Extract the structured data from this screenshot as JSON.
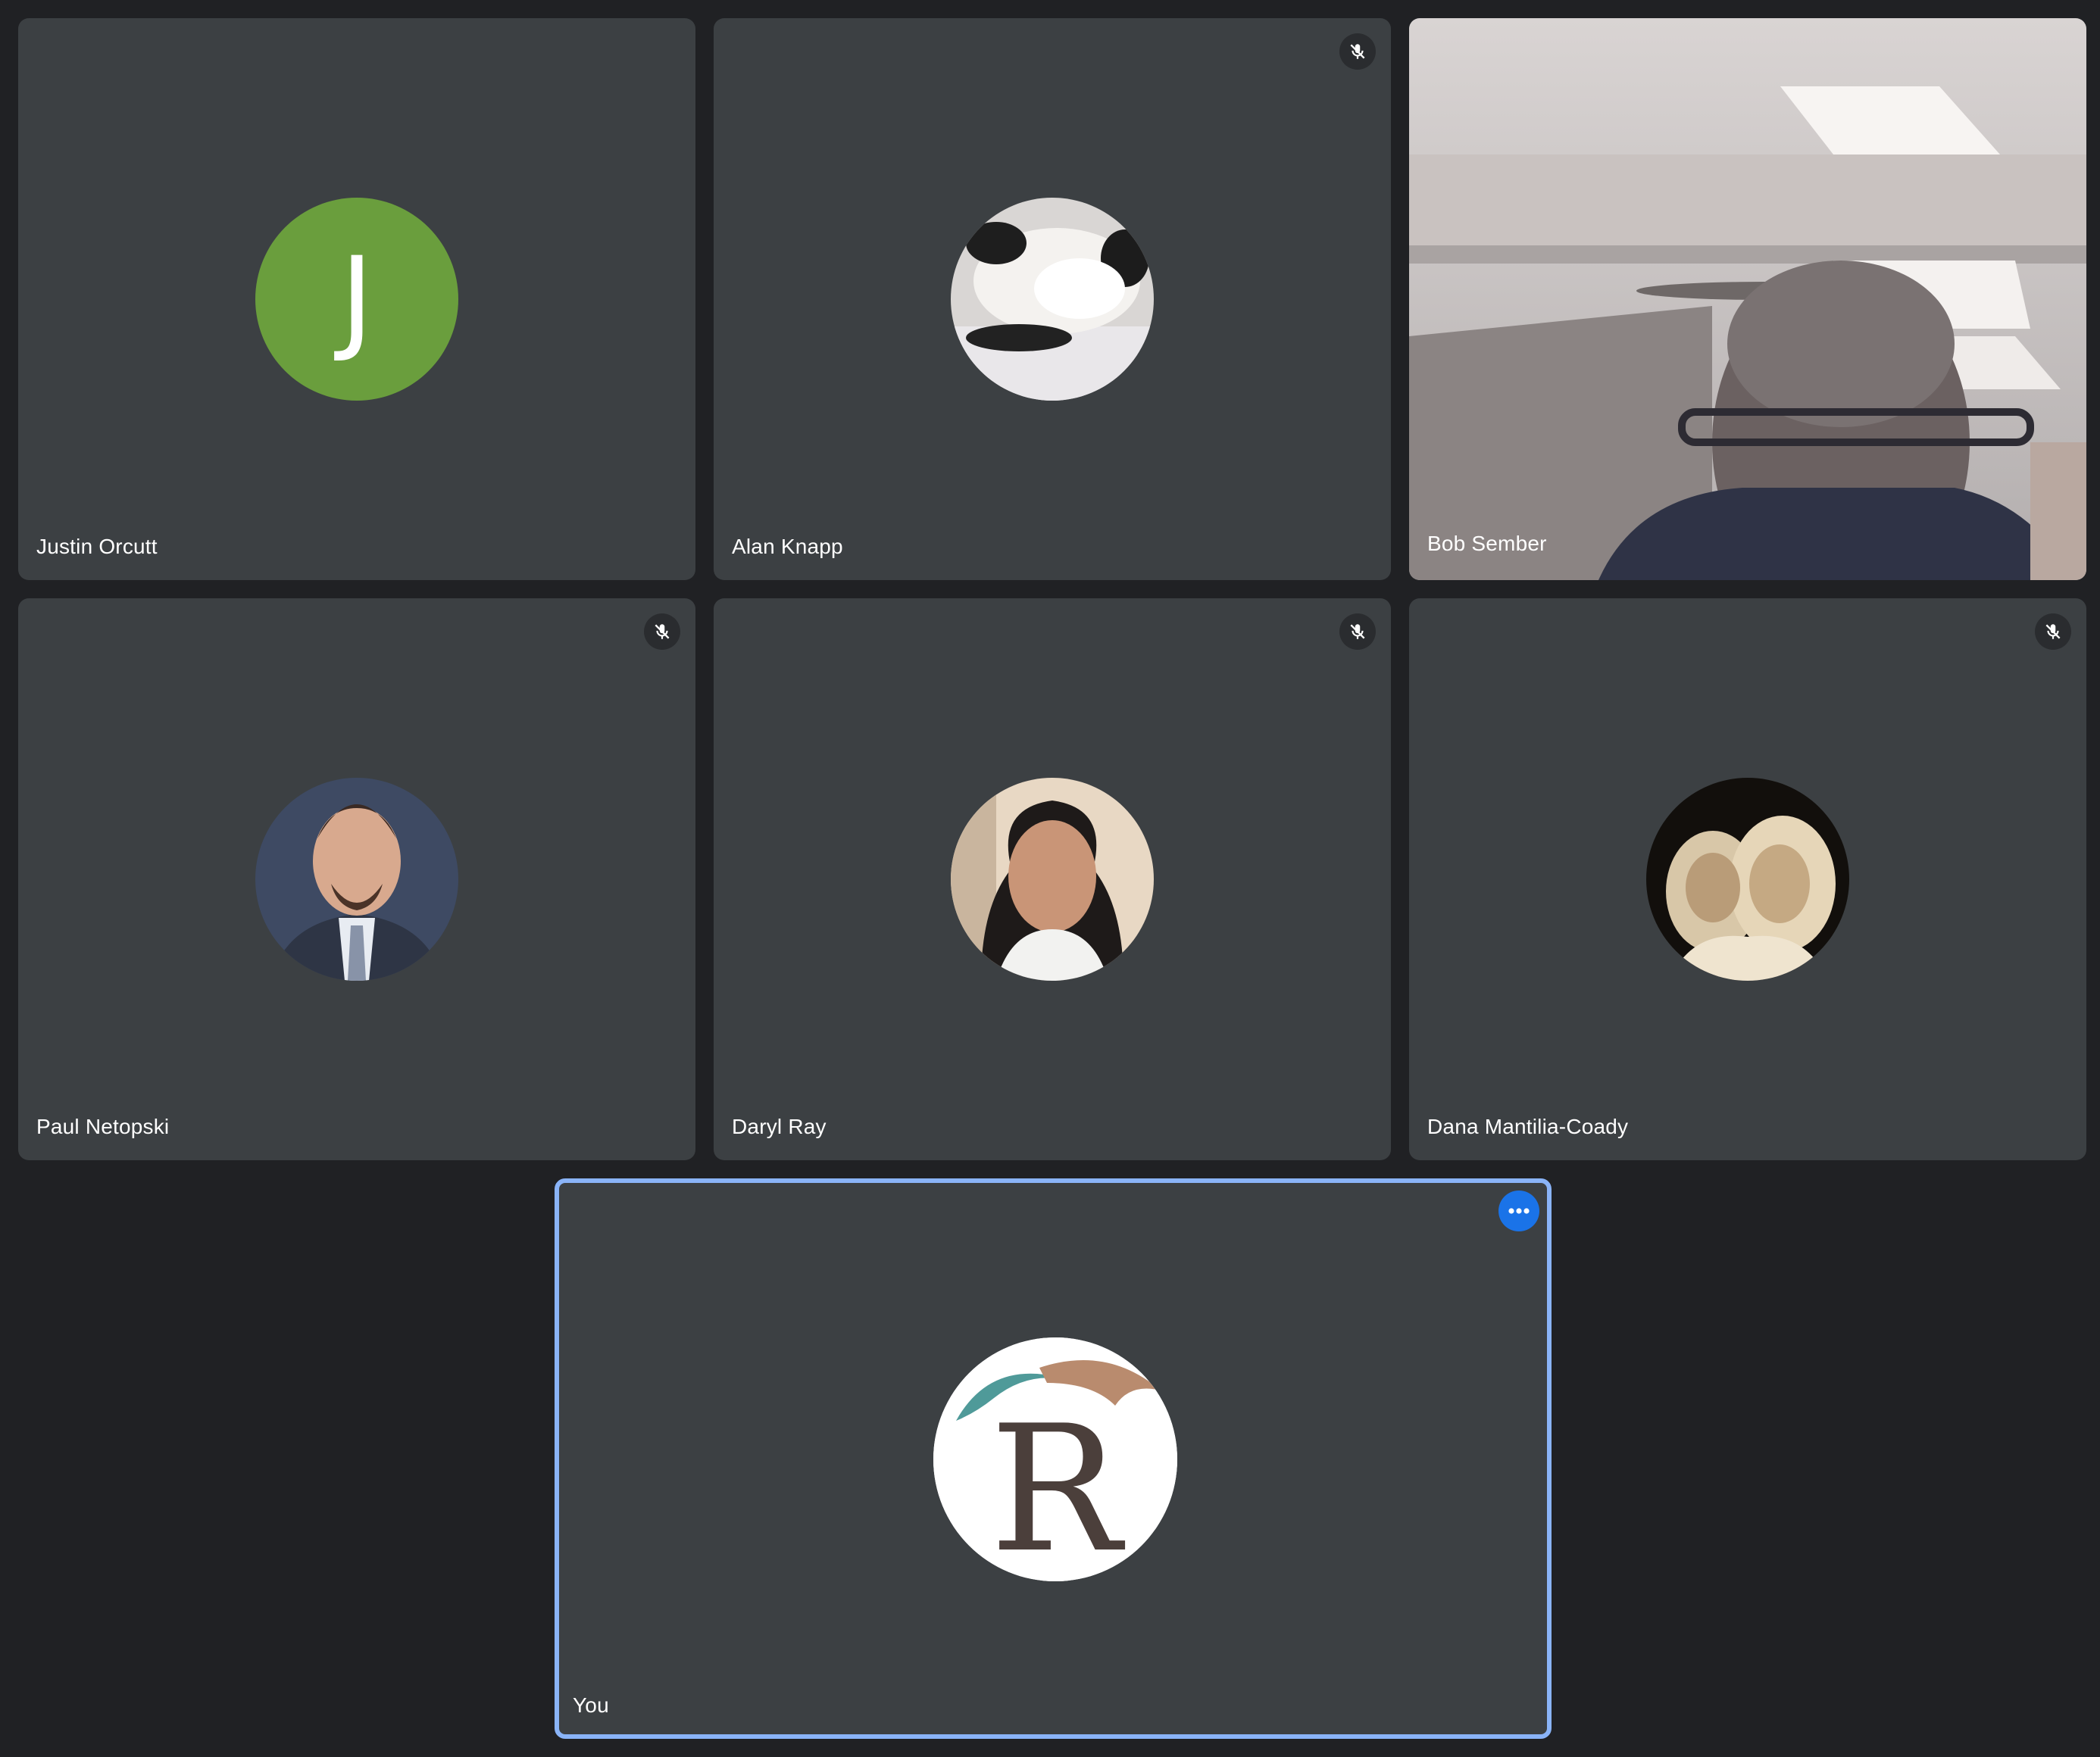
{
  "colors": {
    "page_background": "#202124",
    "tile_background": "#3c4043",
    "self_border": "#8ab4f8",
    "more_button": "#1a73e8",
    "initial_avatar": "#6a9e3d"
  },
  "participants": [
    {
      "name": "Justin Orcutt",
      "avatar_type": "initial",
      "initial": "J",
      "muted": false,
      "video_on": false
    },
    {
      "name": "Alan Knapp",
      "avatar_type": "photo",
      "avatar_subject": "cat",
      "muted": true,
      "video_on": false
    },
    {
      "name": "Bob Sember",
      "avatar_type": "video",
      "muted": false,
      "video_on": true
    },
    {
      "name": "Paul Netopski",
      "avatar_type": "photo",
      "avatar_subject": "man-in-suit",
      "muted": true,
      "video_on": false
    },
    {
      "name": "Daryl Ray",
      "avatar_type": "photo",
      "avatar_subject": "woman-portrait",
      "muted": true,
      "video_on": false
    },
    {
      "name": "Dana Mantilia-Coady",
      "avatar_type": "photo",
      "avatar_subject": "two-girls-sepia",
      "muted": true,
      "video_on": false
    }
  ],
  "self": {
    "name": "You",
    "avatar_type": "logo",
    "logo_letter": "R",
    "more_options_icon": "more-horiz-icon"
  },
  "icons": {
    "mute": "mic-off-icon",
    "more": "more-horiz-icon"
  }
}
